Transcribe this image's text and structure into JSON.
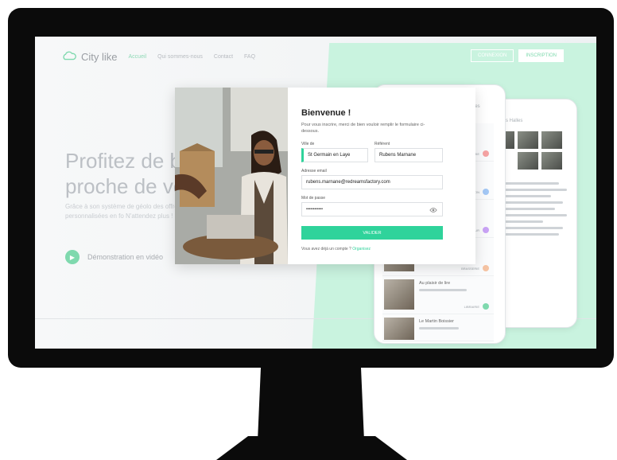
{
  "brand": {
    "name": "City like"
  },
  "nav": {
    "links": [
      "Accueil",
      "Qui sommes-nous",
      "Contact",
      "FAQ"
    ],
    "connexion": "CONNEXION",
    "inscription": "INSCRIPTION"
  },
  "hero": {
    "title": "Profitez de b proche de vo",
    "subtitle": "Grâce à son système de géolo des offres personnalisées en fo N'attendez plus !",
    "demo": "Démonstration en vidéo"
  },
  "modal": {
    "title": "Bienvenue !",
    "subtitle": "Pour vous inscrire, merci de bien vouloir remplir le formulaire ci-dessous.",
    "ville_label": "Ville de",
    "ville_value": "St Germain en Laye",
    "referent_label": "Référent",
    "referent_value": "Rubens Marnane",
    "email_label": "Adresse email",
    "email_value": "rubens.marnane@redreamsfactory.com",
    "password_label": "Mot de passe",
    "password_value": "••••••••••••",
    "submit": "VALIDER",
    "footer_text": "Vous avez déjà un compte ?",
    "footer_link": "Organisez"
  },
  "phone": {
    "items": [
      {
        "title": "",
        "tag": "BOULANGERIE"
      },
      {
        "title": "",
        "tag": "RESTAURATION"
      },
      {
        "title": "",
        "tag": "COIFFEUR"
      },
      {
        "title": "",
        "tag": "BRASSERIE"
      },
      {
        "title": "Au plaisir de lire",
        "tag": "LIBRAIRIE"
      },
      {
        "title": "Le Martin Boissier",
        "tag": ""
      }
    ],
    "header": "Halles",
    "header2": "rie des Halles"
  },
  "colors": {
    "accent": "#2fd39b",
    "green_panel": "#c9f3df"
  }
}
